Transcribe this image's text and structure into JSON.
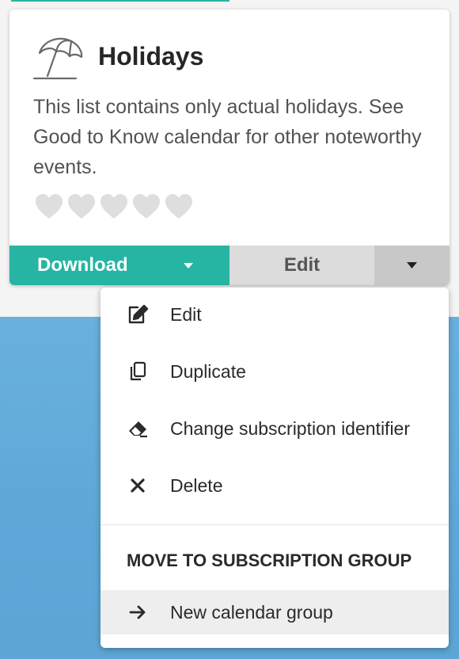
{
  "card": {
    "title": "Holidays",
    "description": "This list contains only actual holidays. See Good to Know calendar for other noteworthy events.",
    "rating": 0,
    "rating_max": 5,
    "icon": "beach-umbrella-icon"
  },
  "footer": {
    "download_label": "Download",
    "edit_label": "Edit"
  },
  "menu": {
    "items": [
      {
        "label": "Edit",
        "icon": "edit-icon"
      },
      {
        "label": "Duplicate",
        "icon": "duplicate-icon"
      },
      {
        "label": "Change subscription identifier",
        "icon": "eraser-icon"
      },
      {
        "label": "Delete",
        "icon": "close-icon"
      }
    ],
    "section_header": "MOVE TO SUBSCRIPTION GROUP",
    "group_items": [
      {
        "label": "New calendar group",
        "icon": "arrow-right-icon"
      }
    ]
  },
  "colors": {
    "accent": "#26b5a3",
    "background_blue": "#5da8d8",
    "heart_empty": "#dedede"
  }
}
